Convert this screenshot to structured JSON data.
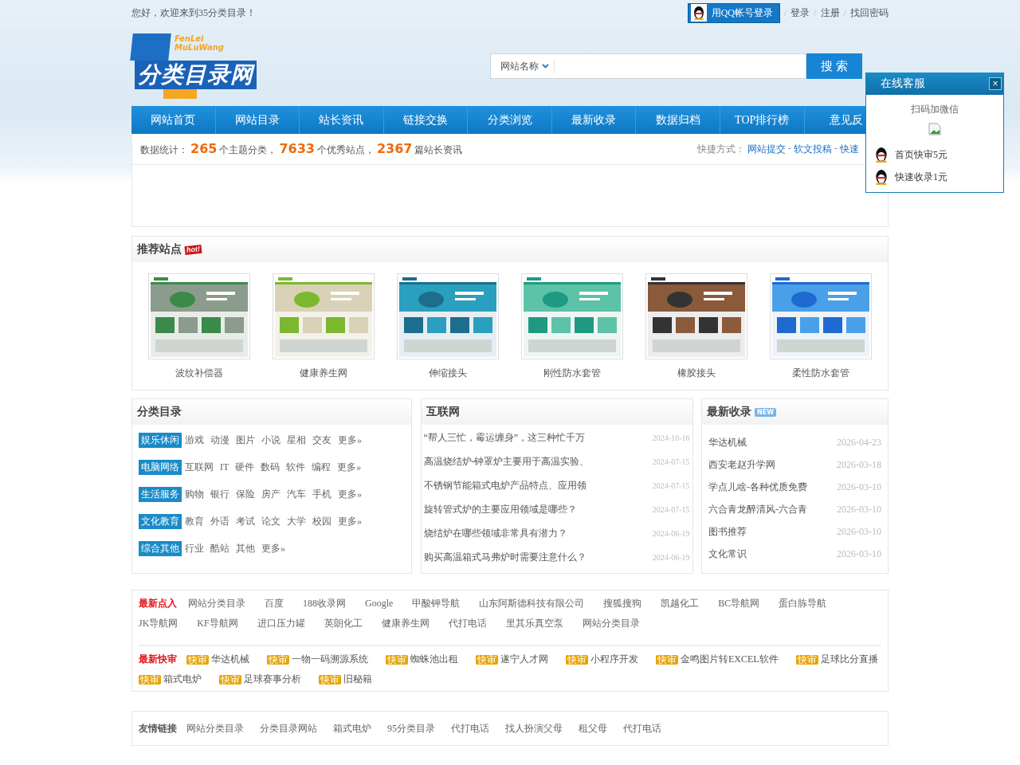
{
  "top_bar": {
    "greeting": "您好，欢迎来到35分类目录！",
    "qq_login": "用QQ帐号登录",
    "separator": "/",
    "links": [
      "登录",
      "注册",
      "找回密码"
    ]
  },
  "logo": {
    "subtitle_lines": [
      "FenLei",
      "MuLuWang"
    ],
    "title": "分类目录网"
  },
  "search": {
    "category": "网站名称",
    "button": "搜 索"
  },
  "nav": [
    "网站首页",
    "网站目录",
    "站长资讯",
    "链接交换",
    "分类浏览",
    "最新收录",
    "数据归档",
    "TOP排行榜",
    "意见反"
  ],
  "stats": {
    "parts": [
      {
        "kind": "text",
        "text": "数据统计："
      },
      {
        "kind": "number",
        "text": "265"
      },
      {
        "kind": "text",
        "text": "个主题分类，"
      },
      {
        "kind": "number",
        "text": "7633"
      },
      {
        "kind": "text",
        "text": "个优秀站点，"
      },
      {
        "kind": "number",
        "text": "2367"
      },
      {
        "kind": "text",
        "text": "篇站长资讯"
      }
    ],
    "shortcut_label": "快捷方式：",
    "separator": "-",
    "shortcuts": [
      "网站提交",
      "软文投稿",
      "快速"
    ]
  },
  "recommended": {
    "title": "推荐站点",
    "badge": "hot!",
    "sites": [
      {
        "name": "波纹补偿器",
        "kind": "picture"
      },
      {
        "name": "健康养生网",
        "kind": "picture"
      },
      {
        "name": "伸缩接头",
        "kind": "picture"
      },
      {
        "name": "刚性防水套管",
        "kind": "picture"
      },
      {
        "name": "橡胶接头",
        "kind": "picture"
      },
      {
        "name": "柔性防水套管",
        "kind": "picture"
      }
    ]
  },
  "categories": {
    "title": "分类目录",
    "rows": [
      {
        "label": "娱乐休闲",
        "items": [
          "游戏",
          "动漫",
          "图片",
          "小说",
          "星相",
          "交友"
        ],
        "more": "更多»"
      },
      {
        "label": "电脑网络",
        "items": [
          "互联网",
          "IT",
          "硬件",
          "数码",
          "软件",
          "编程"
        ],
        "more": "更多»"
      },
      {
        "label": "生活服务",
        "items": [
          "购物",
          "银行",
          "保险",
          "房产",
          "汽车",
          "手机"
        ],
        "more": "更多»"
      },
      {
        "label": "文化教育",
        "items": [
          "教育",
          "外语",
          "考试",
          "论文",
          "大学",
          "校园"
        ],
        "more": "更多»"
      },
      {
        "label": "综合其他",
        "items": [
          "行业",
          "酷站",
          "其他"
        ],
        "more": "更多»"
      }
    ]
  },
  "internet": {
    "title": "互联网",
    "articles": [
      {
        "title": "“帮人三忙，霉运缠身”，这三种忙千万",
        "date": "2024-10-16"
      },
      {
        "title": "高温烧结炉-钟罩炉主要用于高温实验、",
        "date": "2024-07-15"
      },
      {
        "title": "不锈钢节能箱式电炉产品特点、应用领",
        "date": "2024-07-15"
      },
      {
        "title": "旋转管式炉的主要应用领域是哪些？",
        "date": "2024-07-15"
      },
      {
        "title": "烧结炉在哪些领域非常具有潜力？",
        "date": "2024-06-19"
      },
      {
        "title": "购买高温箱式马弗炉时需要注意什么？",
        "date": "2024-06-19"
      }
    ]
  },
  "latest": {
    "title": "最新收录",
    "badge": "NEW",
    "items": [
      {
        "name": "华达机械",
        "date": "2026-04-23"
      },
      {
        "name": "西安老赵升学网",
        "date": "2026-03-18"
      },
      {
        "name": "学点儿啥-各种优质免费",
        "date": "2026-03-10"
      },
      {
        "name": "六合青龙醉清风-六合青",
        "date": "2026-03-10"
      },
      {
        "name": "图书推荐",
        "date": "2026-03-10"
      },
      {
        "name": "文化常识",
        "date": "2026-03-10"
      }
    ]
  },
  "latest_clicks": {
    "label": "最新点入",
    "links": [
      "网站分类目录",
      "百度",
      "188收录网",
      "Google",
      "甲酸钾导航",
      "山东阿斯德科技有限公司",
      "搜狐搜狗",
      "凯越化工",
      "BC导航网",
      "蛋白胨导航",
      "JK导航网",
      "KF导航网",
      "进口压力罐",
      "英朗化工",
      "健康养生网",
      "代打电话",
      "里其乐真空泵",
      "网站分类目录"
    ]
  },
  "fast_review": {
    "label": "最新快审",
    "items": [
      {
        "badge": "快审",
        "name": "华达机械"
      },
      {
        "badge": "快审",
        "name": "一物一码溯源系统"
      },
      {
        "badge": "快审",
        "name": "蜘蛛池出租"
      },
      {
        "badge": "快审",
        "name": "遂宁人才网"
      },
      {
        "badge": "快审",
        "name": "小程序开发"
      },
      {
        "badge": "快审",
        "name": "金鸣图片转EXCEL软件"
      },
      {
        "badge": "快审",
        "name": "足球比分直播"
      },
      {
        "badge": "快审",
        "name": "箱式电炉"
      },
      {
        "badge": "快审",
        "name": "足球赛事分析"
      },
      {
        "badge": "快审",
        "name": "旧秘籍"
      }
    ]
  },
  "friend_links": {
    "label": "友情链接",
    "links": [
      "网站分类目录",
      "分类目录网站",
      "箱式电炉",
      "95分类目录",
      "代打电话",
      "找人扮演父母",
      "租父母",
      "代打电话"
    ]
  },
  "widget": {
    "title": "在线客服",
    "close": "×",
    "qr_label": "扫码加微信",
    "contacts": [
      "首页快审5元",
      "快速收录1元"
    ]
  }
}
